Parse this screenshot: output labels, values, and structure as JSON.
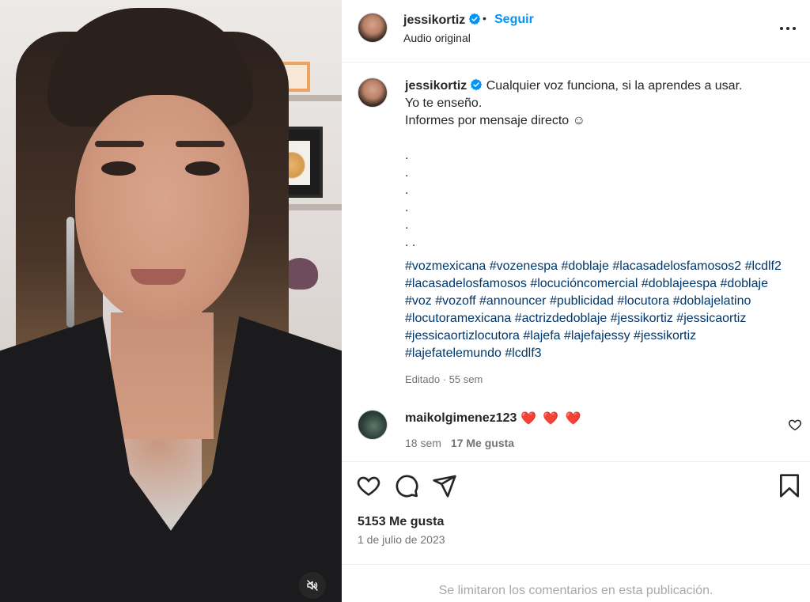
{
  "colors": {
    "accent_blue": "#0095f6",
    "hashtag": "#00376b",
    "muted_text": "#737373",
    "heart_red": "#e0245e"
  },
  "media": {
    "mute_icon": "speaker-muted-icon"
  },
  "header": {
    "username": "jessikortiz",
    "verified_icon": "verified-badge-icon",
    "separator": "•",
    "follow_label": "Seguir",
    "audio_label": "Audio original",
    "more_icon": "more-options-icon"
  },
  "caption": {
    "username": "jessikortiz",
    "line1": "Cualquier voz funciona, si la aprendes a usar.",
    "line2": "Yo te enseño.",
    "line3": "Informes por mensaje directo ☺",
    "dots": [
      ".",
      ".",
      ".",
      ".",
      ".",
      ". ."
    ],
    "hashtags": "#vozmexicana #vozenespa #doblaje #lacasadelosfamosos2 #lcdlf2 #lacasadelosfamosos #locucióncomercial #doblajeespa #doblaje #voz #vozoff #announcer #publicidad #locutora #doblajelatino #locutoramexicana #actrizdedoblaje #jessikortiz #jessicaortiz #jessicaortizlocutora #lajefa #lajefajessy #jessikortiz #lajefatelemundo #lcdlf3",
    "edited": "Editado · 55 sem"
  },
  "comment": {
    "username": "maikolgimenez123",
    "text": "❤️ ❤️ ❤️",
    "age": "18 sem",
    "likes": "17 Me gusta",
    "like_icon": "heart-outline-icon"
  },
  "actions": {
    "like_icon": "heart-icon",
    "comment_icon": "comment-icon",
    "share_icon": "share-icon",
    "save_icon": "bookmark-icon",
    "likes_count": "5153 Me gusta",
    "date": "1 de julio de 2023"
  },
  "footer": {
    "limited_comments": "Se limitaron los comentarios en esta publicación."
  }
}
